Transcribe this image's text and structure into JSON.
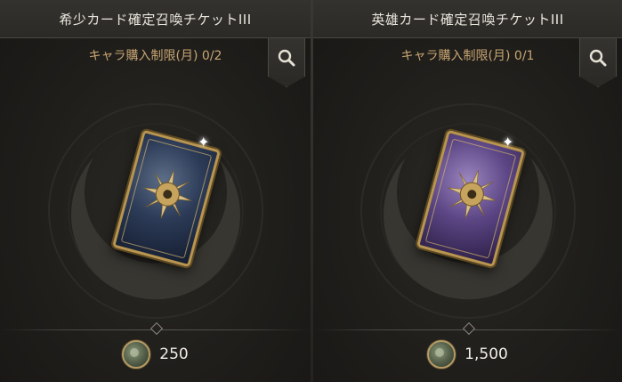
{
  "cards": [
    {
      "title": "希少カード確定召喚チケットIII",
      "limit": "キャラ購入制限(月) 0/2",
      "price": "250"
    },
    {
      "title": "英雄カード確定召喚チケットIII",
      "limit": "キャラ購入制限(月) 0/1",
      "price": "1,500"
    }
  ],
  "colors": {
    "title_text": "#e9e5dc",
    "limit_text": "#c9a572",
    "rare_card": "#2c3b57",
    "hero_card": "#5d4786",
    "card_frame": "#b89550"
  },
  "icons": {
    "search": "magnifier-icon",
    "currency": "coin-icon"
  }
}
